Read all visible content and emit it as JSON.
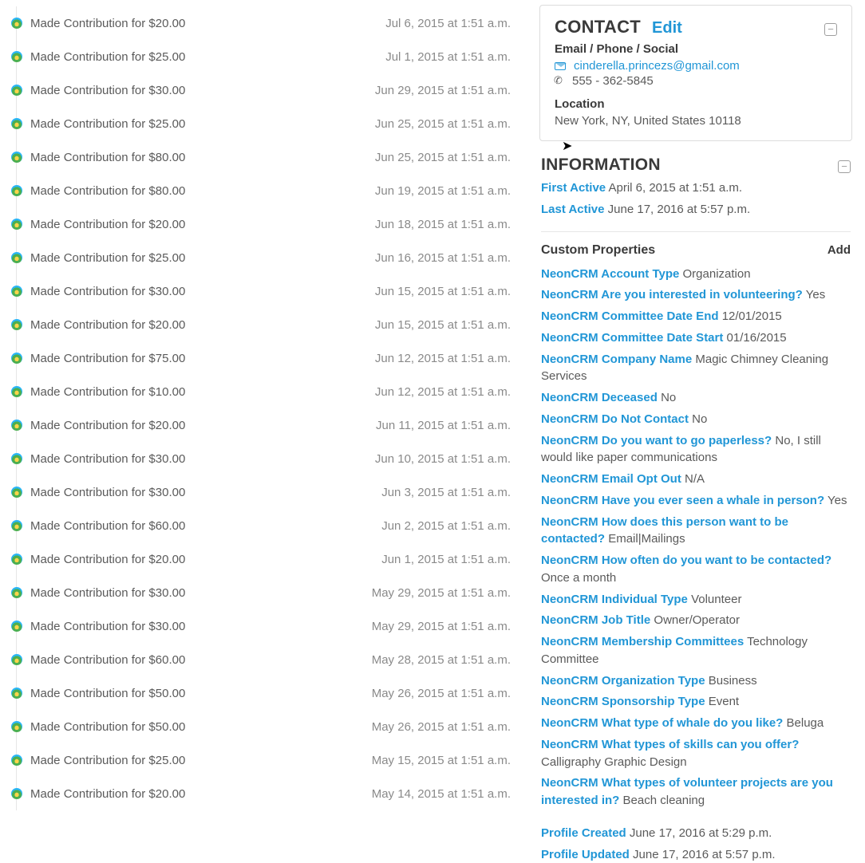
{
  "activities": [
    {
      "text": "Made Contribution for $20.00",
      "date": "Jul 6, 2015 at 1:51 a.m."
    },
    {
      "text": "Made Contribution for $25.00",
      "date": "Jul 1, 2015 at 1:51 a.m."
    },
    {
      "text": "Made Contribution for $30.00",
      "date": "Jun 29, 2015 at 1:51 a.m."
    },
    {
      "text": "Made Contribution for $25.00",
      "date": "Jun 25, 2015 at 1:51 a.m."
    },
    {
      "text": "Made Contribution for $80.00",
      "date": "Jun 25, 2015 at 1:51 a.m."
    },
    {
      "text": "Made Contribution for $80.00",
      "date": "Jun 19, 2015 at 1:51 a.m."
    },
    {
      "text": "Made Contribution for $20.00",
      "date": "Jun 18, 2015 at 1:51 a.m."
    },
    {
      "text": "Made Contribution for $25.00",
      "date": "Jun 16, 2015 at 1:51 a.m."
    },
    {
      "text": "Made Contribution for $30.00",
      "date": "Jun 15, 2015 at 1:51 a.m."
    },
    {
      "text": "Made Contribution for $20.00",
      "date": "Jun 15, 2015 at 1:51 a.m."
    },
    {
      "text": "Made Contribution for $75.00",
      "date": "Jun 12, 2015 at 1:51 a.m."
    },
    {
      "text": "Made Contribution for $10.00",
      "date": "Jun 12, 2015 at 1:51 a.m."
    },
    {
      "text": "Made Contribution for $20.00",
      "date": "Jun 11, 2015 at 1:51 a.m."
    },
    {
      "text": "Made Contribution for $30.00",
      "date": "Jun 10, 2015 at 1:51 a.m."
    },
    {
      "text": "Made Contribution for $30.00",
      "date": "Jun 3, 2015 at 1:51 a.m."
    },
    {
      "text": "Made Contribution for $60.00",
      "date": "Jun 2, 2015 at 1:51 a.m."
    },
    {
      "text": "Made Contribution for $20.00",
      "date": "Jun 1, 2015 at 1:51 a.m."
    },
    {
      "text": "Made Contribution for $30.00",
      "date": "May 29, 2015 at 1:51 a.m."
    },
    {
      "text": "Made Contribution for $30.00",
      "date": "May 29, 2015 at 1:51 a.m."
    },
    {
      "text": "Made Contribution for $60.00",
      "date": "May 28, 2015 at 1:51 a.m."
    },
    {
      "text": "Made Contribution for $50.00",
      "date": "May 26, 2015 at 1:51 a.m."
    },
    {
      "text": "Made Contribution for $50.00",
      "date": "May 26, 2015 at 1:51 a.m."
    },
    {
      "text": "Made Contribution for $25.00",
      "date": "May 15, 2015 at 1:51 a.m."
    },
    {
      "text": "Made Contribution for $20.00",
      "date": "May 14, 2015 at 1:51 a.m."
    }
  ],
  "contact": {
    "title": "CONTACT",
    "edit": "Edit",
    "section1_label": "Email / Phone / Social",
    "email": "cinderella.princezs@gmail.com",
    "phone": "555 - 362-5845",
    "section2_label": "Location",
    "location": "New York, NY, United States 10118"
  },
  "info": {
    "title": "INFORMATION",
    "first_active_label": "First Active",
    "first_active_value": "April 6, 2015 at 1:51 a.m.",
    "last_active_label": "Last Active",
    "last_active_value": "June 17, 2016 at 5:57 p.m.",
    "custom_title": "Custom Properties",
    "add_label": "Add",
    "props": [
      {
        "label": "NeonCRM Account Type",
        "value": "Organization"
      },
      {
        "label": "NeonCRM Are you interested in volunteering?",
        "value": "Yes"
      },
      {
        "label": "NeonCRM Committee Date End",
        "value": "12/01/2015"
      },
      {
        "label": "NeonCRM Committee Date Start",
        "value": "01/16/2015"
      },
      {
        "label": "NeonCRM Company Name",
        "value": "Magic Chimney Cleaning Services"
      },
      {
        "label": "NeonCRM Deceased",
        "value": "No"
      },
      {
        "label": "NeonCRM Do Not Contact",
        "value": "No"
      },
      {
        "label": "NeonCRM Do you want to go paperless?",
        "value": "No, I still would like paper communications"
      },
      {
        "label": "NeonCRM Email Opt Out",
        "value": "N/A"
      },
      {
        "label": "NeonCRM Have you ever seen a whale in person?",
        "value": "Yes"
      },
      {
        "label": "NeonCRM How does this person want to be contacted?",
        "value": "Email|Mailings"
      },
      {
        "label": "NeonCRM How often do you want to be contacted?",
        "value": "Once a month"
      },
      {
        "label": "NeonCRM Individual Type",
        "value": "Volunteer"
      },
      {
        "label": "NeonCRM Job Title",
        "value": "Owner/Operator"
      },
      {
        "label": "NeonCRM Membership Committees",
        "value": "Technology Committee"
      },
      {
        "label": "NeonCRM Organization Type",
        "value": "Business"
      },
      {
        "label": "NeonCRM Sponsorship Type",
        "value": "Event"
      },
      {
        "label": "NeonCRM What type of whale do you like?",
        "value": "Beluga"
      },
      {
        "label": "NeonCRM What types of skills can you offer?",
        "value": "Calligraphy Graphic Design"
      },
      {
        "label": "NeonCRM What types of volunteer projects are you interested in?",
        "value": "Beach cleaning"
      }
    ],
    "profile_created_label": "Profile Created",
    "profile_created_value": "June 17, 2016 at 5:29 p.m.",
    "profile_updated_label": "Profile Updated",
    "profile_updated_value": "June 17, 2016 at 5:57 p.m."
  }
}
